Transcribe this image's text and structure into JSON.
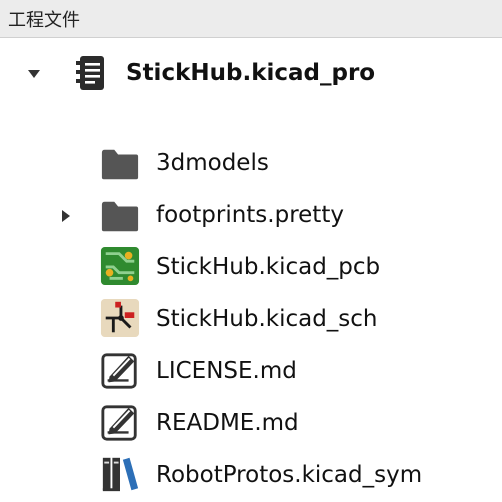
{
  "panel": {
    "title": "工程文件"
  },
  "tree": {
    "project": {
      "name": "StickHub.kicad_pro",
      "icon": "project-file-icon",
      "expanded": true
    },
    "items": [
      {
        "name": "3dmodels",
        "icon": "folder-icon"
      },
      {
        "name": "footprints.pretty",
        "icon": "folder-icon",
        "expandable": true
      },
      {
        "name": "StickHub.kicad_pcb",
        "icon": "pcb-file-icon"
      },
      {
        "name": "StickHub.kicad_sch",
        "icon": "schematic-file-icon"
      },
      {
        "name": "LICENSE.md",
        "icon": "text-file-icon"
      },
      {
        "name": "README.md",
        "icon": "text-file-icon"
      },
      {
        "name": "RobotProtos.kicad_sym",
        "icon": "symbol-library-icon"
      }
    ]
  },
  "colors": {
    "header_bg": "#ececec",
    "folder": "#555555",
    "pcb_green": "#2f8a2f",
    "pcb_pad": "#e8b020",
    "sch_bg": "#e8d9bd",
    "sch_red": "#cc2020"
  }
}
